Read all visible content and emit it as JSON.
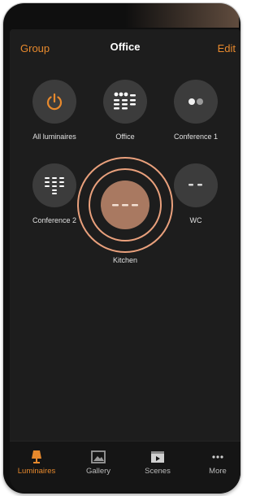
{
  "header": {
    "left": "Group",
    "title": "Office",
    "right": "Edit"
  },
  "groups": [
    {
      "label": "All luminaires",
      "icon": "power-icon"
    },
    {
      "label": "Office",
      "icon": "office-luminaires-icon"
    },
    {
      "label": "Conference 1",
      "icon": "conference-1-luminaires-icon"
    },
    {
      "label": "Conference 2",
      "icon": "conference-2-luminaires-icon"
    },
    {
      "label": "Kitchen",
      "icon": "kitchen-luminaires-icon",
      "selected": true
    },
    {
      "label": "WC",
      "icon": "wc-luminaires-icon"
    }
  ],
  "tabs": [
    {
      "label": "Luminaires",
      "icon": "lamp-icon",
      "active": true
    },
    {
      "label": "Gallery",
      "icon": "gallery-icon"
    },
    {
      "label": "Scenes",
      "icon": "scenes-icon"
    },
    {
      "label": "More",
      "icon": "more-dots-icon"
    }
  ],
  "colors": {
    "accent": "#e7892d",
    "selected_fill": "#a97961",
    "selected_ring": "#e9a07c",
    "tile_bg": "#3c3c3c"
  }
}
